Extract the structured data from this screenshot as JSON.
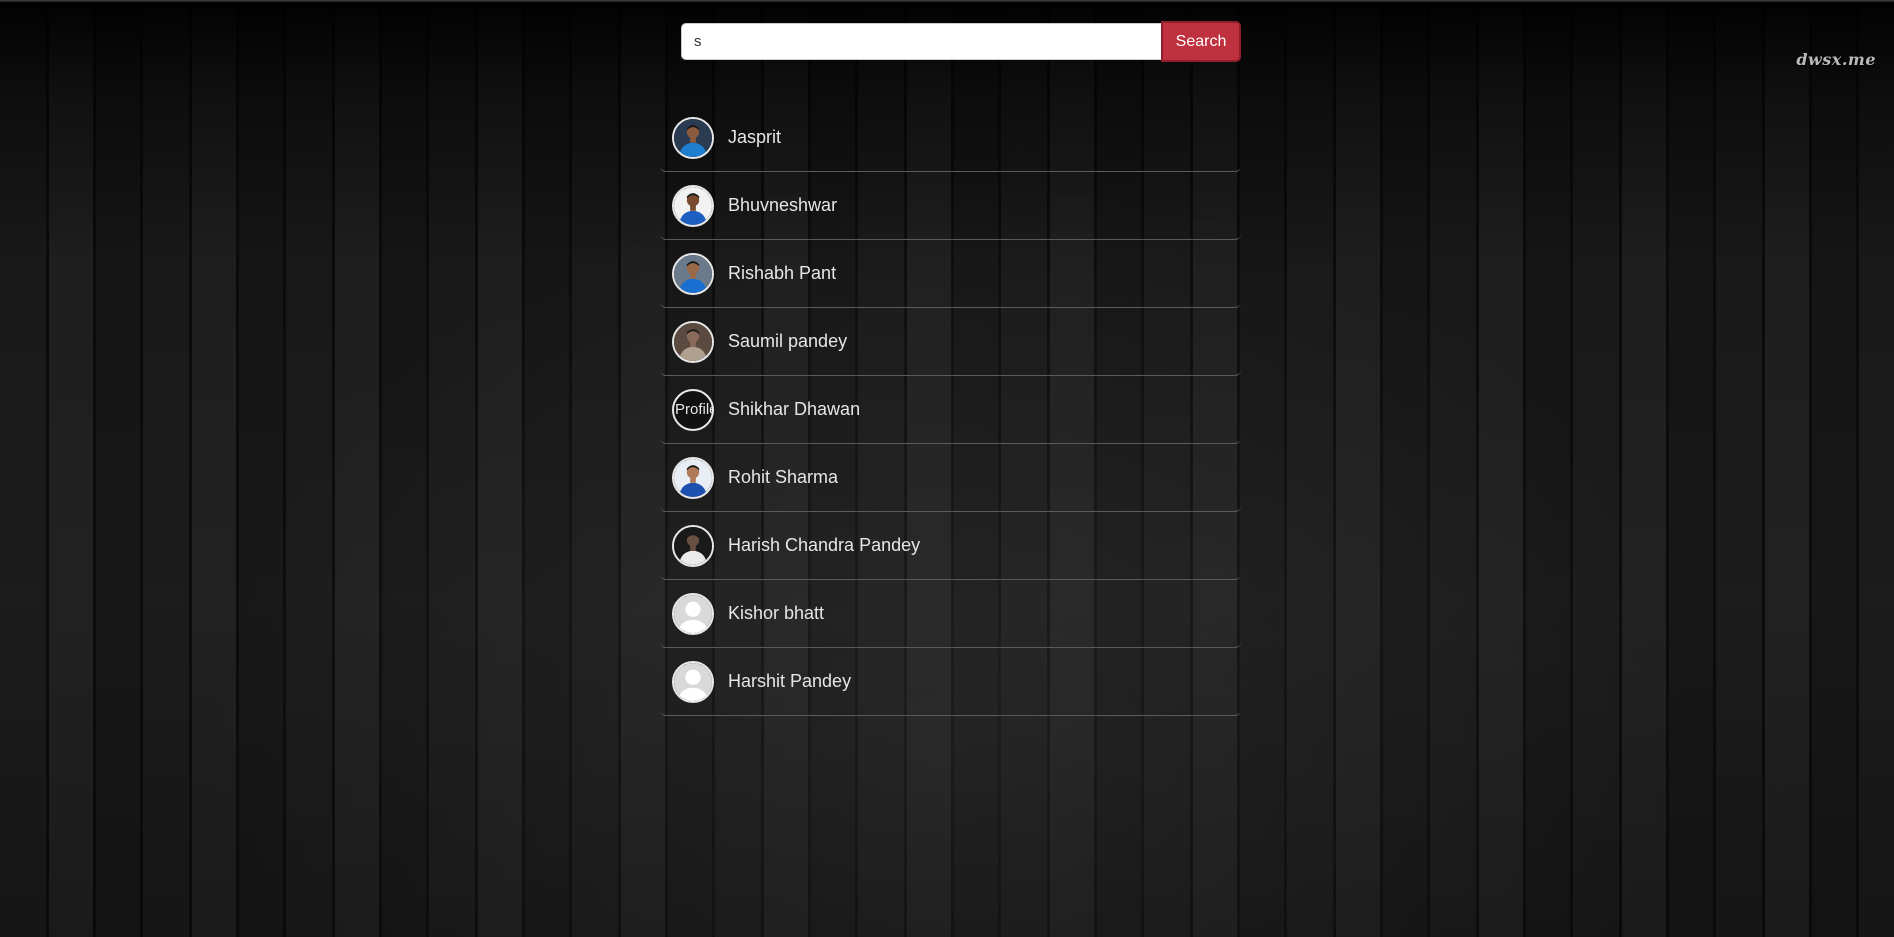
{
  "watermark": "dwsx.me",
  "search": {
    "value": "s",
    "placeholder": "",
    "button_label": "Search"
  },
  "results": [
    {
      "name": "Jasprit",
      "avatar": "photo",
      "skin": "#8a5a3c",
      "shirt": "#1e7fd0",
      "bg": "#2b3b52"
    },
    {
      "name": "Bhuvneshwar",
      "avatar": "photo",
      "skin": "#7a4a30",
      "shirt": "#1b5fc0",
      "bg": "#f2f2f2"
    },
    {
      "name": "Rishabh Pant",
      "avatar": "photo",
      "skin": "#9a6a48",
      "shirt": "#1a6fd0",
      "bg": "#6b7a8a"
    },
    {
      "name": "Saumil pandey",
      "avatar": "photo",
      "skin": "#8a6a58",
      "shirt": "#b0a090",
      "bg": "#5a4a40"
    },
    {
      "name": "Shikhar Dhawan",
      "avatar": "broken",
      "alt": "Profile"
    },
    {
      "name": "Rohit Sharma",
      "avatar": "photo",
      "skin": "#b07a58",
      "shirt": "#1e50b0",
      "bg": "#e8eef4"
    },
    {
      "name": "Harish Chandra Pandey",
      "avatar": "photo",
      "skin": "#6a5040",
      "shirt": "#eaeaea",
      "bg": "#1a1a1a"
    },
    {
      "name": "Kishor bhatt",
      "avatar": "placeholder"
    },
    {
      "name": "Harshit Pandey",
      "avatar": "placeholder"
    }
  ]
}
